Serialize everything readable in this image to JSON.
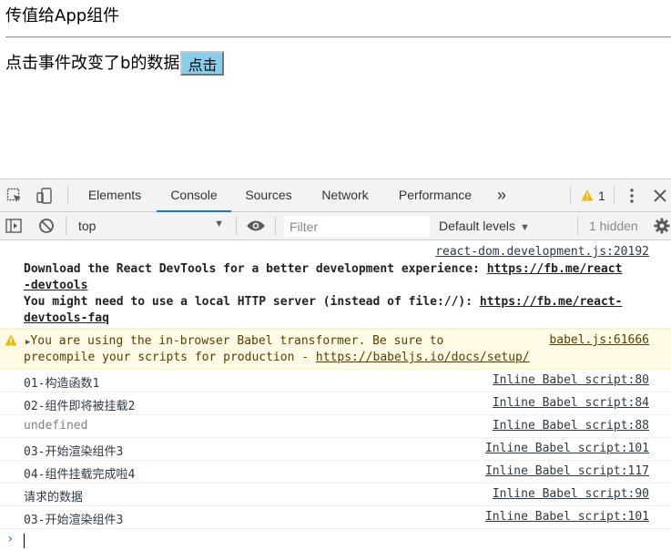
{
  "page": {
    "title": "传值给App组件",
    "line_text": "点击事件改变了b的数据",
    "button_label": "点击"
  },
  "devtools": {
    "tabs": [
      "Elements",
      "Console",
      "Sources",
      "Network",
      "Performance"
    ],
    "active_tab": "Console",
    "more_tabs_glyph": "»",
    "warning_count": "1",
    "context": "top",
    "filter_placeholder": "Filter",
    "levels_label": "Default levels",
    "hidden_label": "1 hidden",
    "colors": {
      "active_tab_underline": "#1a73e8",
      "warning_bg": "#fffbe5",
      "warning_text": "#5c3c00"
    }
  },
  "console": {
    "messages": [
      {
        "source": "react-dom.development.js:20192",
        "line1_prefix": "Download the React DevTools for a better development experience: ",
        "line1_link_a": "https://fb.me/react",
        "line1_link_b": "-devtools",
        "line2_prefix": "You might need to use a local HTTP server (instead of file://): ",
        "line2_link_a": "https://fb.me/react-",
        "line2_link_b": "devtools-faq"
      },
      {
        "level": "warning",
        "source": "babel.js:61666",
        "line1": "You are using the in-browser Babel transformer. Be sure to",
        "line2_prefix": "precompile your scripts for production - ",
        "line2_link": "https://babeljs.io/docs/setup/"
      },
      {
        "text": "01-构造函数1",
        "source": "Inline Babel script:80"
      },
      {
        "text": "02-组件即将被挂载2",
        "source": "Inline Babel script:84"
      },
      {
        "text": "undefined",
        "source": "Inline Babel script:88"
      },
      {
        "text": "03-开始渲染组件3",
        "source": "Inline Babel script:101"
      },
      {
        "text": "04-组件挂载完成啦4",
        "source": "Inline Babel script:117"
      },
      {
        "text": "请求的数据",
        "source": "Inline Babel script:90"
      },
      {
        "text": "03-开始渲染组件3",
        "source": "Inline Babel script:101"
      }
    ],
    "prompt_glyph": "›"
  }
}
